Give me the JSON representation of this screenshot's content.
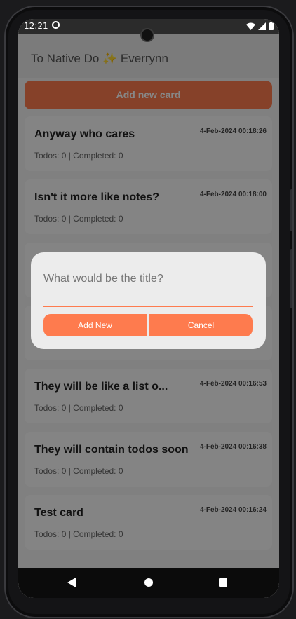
{
  "status_bar": {
    "time": "12:21",
    "icons": [
      "sync-icon",
      "wifi-icon",
      "signal-icon",
      "battery-icon"
    ]
  },
  "header": {
    "title": "To Native Do ✨ Everrynn"
  },
  "add_card_button": "Add new card",
  "cards": [
    {
      "title": "Anyway who cares",
      "date": "4-Feb-2024 00:18:26",
      "stats": "Todos: 0 | Completed: 0"
    },
    {
      "title": "Isn't it more like notes?",
      "date": "4-Feb-2024 00:18:00",
      "stats": "Todos: 0 | Completed: 0"
    },
    {
      "title": "",
      "date": "",
      "stats": ""
    },
    {
      "title": "",
      "date": "",
      "stats": ""
    },
    {
      "title": "They will be like a list o...",
      "date": "4-Feb-2024 00:16:53",
      "stats": "Todos: 0 | Completed: 0"
    },
    {
      "title": "They will contain todos soon",
      "date": "4-Feb-2024 00:16:38",
      "stats": "Todos: 0 | Completed: 0"
    },
    {
      "title": "Test card",
      "date": "4-Feb-2024 00:16:24",
      "stats": "Todos: 0 | Completed: 0"
    }
  ],
  "dialog": {
    "placeholder": "What would be the title?",
    "add_label": "Add New",
    "cancel_label": "Cancel"
  },
  "colors": {
    "accent": "#fe7b4e",
    "card_bg": "#fafafa",
    "screen_bg": "#f1f1f1"
  }
}
